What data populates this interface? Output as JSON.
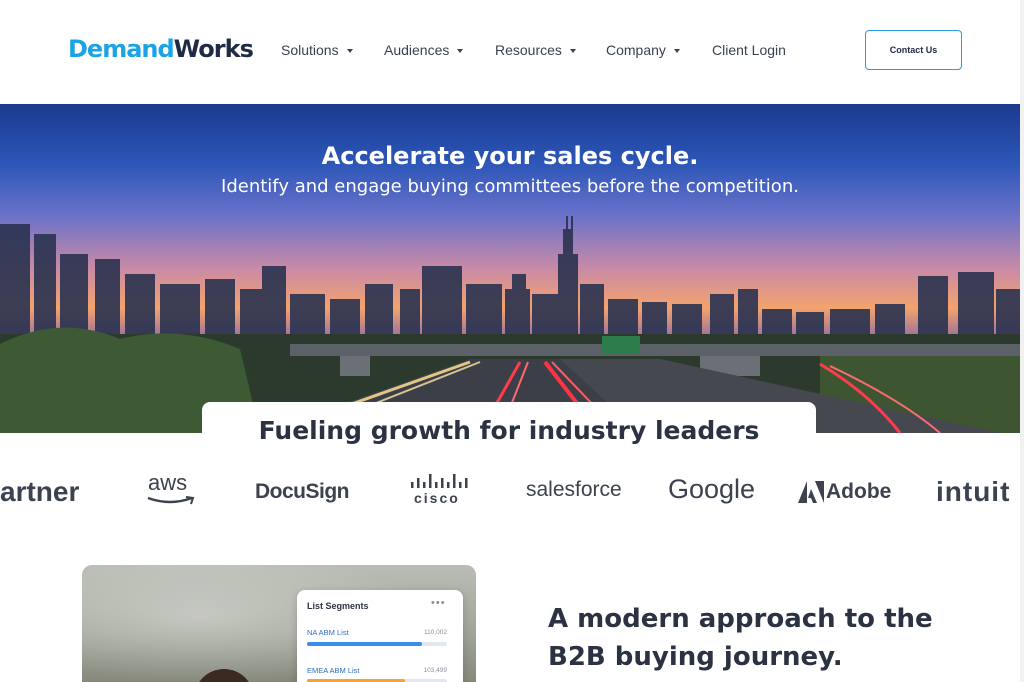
{
  "header": {
    "logo": {
      "part1": "Demand",
      "part2": "Works"
    },
    "nav": [
      {
        "label": "Solutions",
        "has_dropdown": true
      },
      {
        "label": "Audiences",
        "has_dropdown": true
      },
      {
        "label": "Resources",
        "has_dropdown": true
      },
      {
        "label": "Company",
        "has_dropdown": true
      },
      {
        "label": "Client Login",
        "has_dropdown": false
      }
    ],
    "contact_button": "Contact Us"
  },
  "hero": {
    "title": "Accelerate your sales cycle.",
    "subtitle": "Identify and engage buying committees before the competition.",
    "image": "city-skyline-highway-at-dusk"
  },
  "growth": {
    "title": "Fueling growth for industry leaders",
    "logos": [
      "artner",
      "aws",
      "DocuSign",
      "cisco",
      "salesforce",
      "Google",
      "Adobe",
      "intuit"
    ]
  },
  "segments_card": {
    "title": "List Segments",
    "menu_icon": "more-horizontal-icon",
    "items": [
      {
        "label": "NA ABM List",
        "value": "110,002",
        "progress": 0.82,
        "color": "#3a8ee6"
      },
      {
        "label": "EMEA ABM List",
        "value": "103,499",
        "progress": 0.7,
        "color": "#f2a33a"
      }
    ]
  },
  "section": {
    "heading_line1": "A modern approach to the",
    "heading_line2": "B2B buying journey."
  },
  "colors": {
    "brand_blue": "#1ca3e6",
    "brand_navy": "#1f2a44",
    "text": "#2b3242"
  }
}
